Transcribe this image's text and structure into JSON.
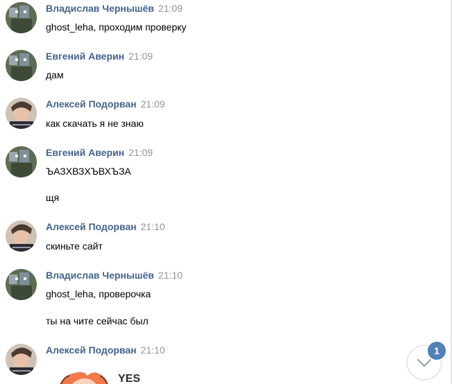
{
  "messages": [
    {
      "author": "Владислав Чернышёв",
      "time": "21:09",
      "avatar": "minecraft",
      "lines": [
        "ghost_leha, проходим проверку"
      ]
    },
    {
      "author": "Евгений Аверин",
      "time": "21:09",
      "avatar": "minecraft",
      "lines": [
        "дам"
      ]
    },
    {
      "author": "Алексей Подорван",
      "time": "21:09",
      "avatar": "photo",
      "lines": [
        "как скачать я не знаю"
      ]
    },
    {
      "author": "Евгений Аверин",
      "time": "21:09",
      "avatar": "minecraft",
      "lines": [
        "ЪАЗХВЗХЪВХЪЗА",
        "щя"
      ]
    },
    {
      "author": "Алексей Подорван",
      "time": "21:10",
      "avatar": "photo",
      "lines": [
        "скиньте сайт"
      ]
    },
    {
      "author": "Владислав Чернышёв",
      "time": "21:10",
      "avatar": "minecraft",
      "lines": [
        "ghost_leha, проверочка",
        "ты на чите сейчас был"
      ]
    },
    {
      "author": "Алексей Подорван",
      "time": "21:10",
      "avatar": "photo",
      "lines": []
    }
  ],
  "sticker_text": "YES",
  "scroll_button": {
    "icon": "chevron-down-icon",
    "unread_count": "1"
  },
  "colors": {
    "author": "#42648b",
    "time": "#939393",
    "badge": "#5181b8"
  }
}
